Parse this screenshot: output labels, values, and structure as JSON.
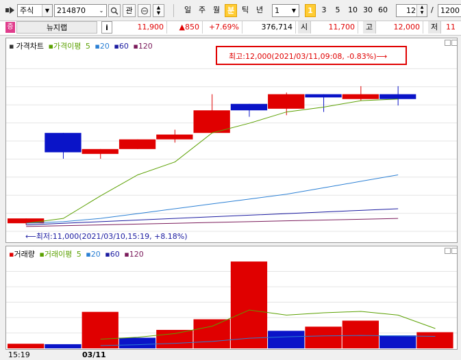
{
  "toolbar": {
    "market_label": "주식",
    "code_value": "214870",
    "interest_label": "관",
    "periods": [
      "일",
      "주",
      "월",
      "분",
      "틱",
      "년"
    ],
    "active_period": "분",
    "interval_value": "1",
    "minute_buttons": [
      "1",
      "3",
      "5",
      "10",
      "30",
      "60"
    ],
    "active_minute": "1",
    "count_value": "12",
    "slash": "/",
    "total_value": "1200"
  },
  "info": {
    "badge": "증",
    "stock_name": "뉴지랩",
    "info_icon": "i",
    "price": "11,900",
    "change": "▲850",
    "change_pct": "+7.69%",
    "volume": "376,714",
    "open_label": "시",
    "open": "11,700",
    "high_label": "고",
    "high": "12,000",
    "low_label": "저",
    "low": "11"
  },
  "price_chart": {
    "legend": {
      "title": "가격차트",
      "ma_label": "가격이평",
      "ma": [
        "5",
        "20",
        "60",
        "120"
      ]
    },
    "annotation_high": "최고:12,000(2021/03/11,09:08, -0.83%)⟶",
    "annotation_low": "⟵최저:11,000(2021/03/10,15:19, +8.18%)"
  },
  "volume_chart": {
    "legend": {
      "title": "거래량",
      "ma_label": "거래이평",
      "ma": [
        "5",
        "20",
        "60",
        "120"
      ]
    }
  },
  "xaxis": {
    "labels": [
      "15:19",
      "03/11"
    ]
  },
  "colors": {
    "up": "#e00000",
    "down": "#0a14c8",
    "ma5": "#5aa000",
    "ma20": "#2a7fd4",
    "ma60": "#1a1aa0",
    "ma120": "#7a1a5a",
    "vol_ma5": "#5aa000",
    "vol_ma20": "#2a7fd4"
  },
  "chart_data": [
    {
      "type": "candlestick",
      "title": "",
      "ylim": [
        10950,
        12070
      ],
      "candles": [
        {
          "open": 11000,
          "close": 11030,
          "high": 11030,
          "low": 10990,
          "dir": "up"
        },
        {
          "open": 11560,
          "close": 11440,
          "high": 11560,
          "low": 11400,
          "dir": "down"
        },
        {
          "open": 11430,
          "close": 11460,
          "high": 11460,
          "low": 11400,
          "dir": "up"
        },
        {
          "open": 11460,
          "close": 11520,
          "high": 11520,
          "low": 11460,
          "dir": "up"
        },
        {
          "open": 11520,
          "close": 11550,
          "high": 11580,
          "low": 11500,
          "dir": "up"
        },
        {
          "open": 11560,
          "close": 11700,
          "high": 11800,
          "low": 11560,
          "dir": "up"
        },
        {
          "open": 11740,
          "close": 11700,
          "high": 11740,
          "low": 11660,
          "dir": "down"
        },
        {
          "open": 11710,
          "close": 11800,
          "high": 11810,
          "low": 11670,
          "dir": "up"
        },
        {
          "open": 11800,
          "close": 11780,
          "high": 11800,
          "low": 11690,
          "dir": "down"
        },
        {
          "open": 11770,
          "close": 11800,
          "high": 11850,
          "low": 11760,
          "dir": "up"
        },
        {
          "open": 11800,
          "close": 11770,
          "high": 11850,
          "low": 11730,
          "dir": "down"
        }
      ],
      "series": [
        {
          "name": "5",
          "values": [
            11000,
            11030,
            11170,
            11300,
            11380,
            11560,
            11620,
            11690,
            11720,
            11760,
            11770
          ]
        },
        {
          "name": "20",
          "values": [
            11000,
            11010,
            11030,
            11060,
            11090,
            11120,
            11150,
            11180,
            11220,
            11260,
            11300
          ]
        },
        {
          "name": "60",
          "values": [
            10990,
            11000,
            11010,
            11020,
            11030,
            11040,
            11050,
            11060,
            11070,
            11080,
            11090
          ]
        },
        {
          "name": "120",
          "values": [
            10980,
            10985,
            10990,
            10995,
            11000,
            11005,
            11010,
            11015,
            11020,
            11025,
            11030
          ]
        }
      ]
    },
    {
      "type": "bar",
      "title": "",
      "ylim": [
        0,
        200
      ],
      "values": [
        10,
        9,
        79,
        23,
        40,
        63,
        188,
        38,
        47,
        60,
        28,
        35
      ],
      "dirs": [
        "up",
        "down",
        "up",
        "down",
        "up",
        "up",
        "up",
        "down",
        "up",
        "up",
        "down",
        "up"
      ],
      "series": [
        {
          "name": "5",
          "values": [
            null,
            null,
            20,
            24,
            32,
            48,
            83,
            72,
            77,
            80,
            72,
            43
          ]
        },
        {
          "name": "20",
          "values": [
            null,
            null,
            6,
            8,
            11,
            15,
            22,
            25,
            27,
            28,
            27,
            26
          ]
        }
      ]
    }
  ]
}
